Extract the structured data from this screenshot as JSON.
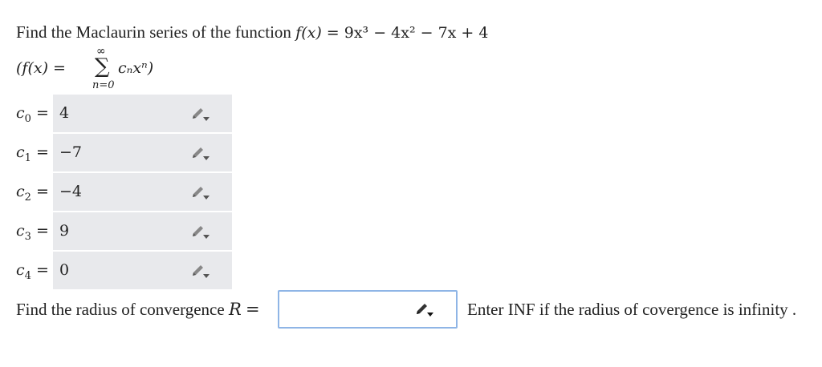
{
  "question": {
    "prefix": "Find the Maclaurin series of the function",
    "function_lhs": "f(x) = ",
    "function_rhs": "9x³ − 4x² − 7x + 4"
  },
  "series_definition": {
    "left": "(f(x) = ",
    "sum_upper": "∞",
    "sum_lower": "n=0",
    "summand": "cₙxⁿ)"
  },
  "coefficients": [
    {
      "label": "c",
      "index": "0",
      "equals": "=",
      "value": "4"
    },
    {
      "label": "c",
      "index": "1",
      "equals": "=",
      "value": "−7"
    },
    {
      "label": "c",
      "index": "2",
      "equals": "=",
      "value": "−4"
    },
    {
      "label": "c",
      "index": "3",
      "equals": "=",
      "value": "9"
    },
    {
      "label": "c",
      "index": "4",
      "equals": "=",
      "value": "0"
    }
  ],
  "radius": {
    "label": "Find the radius of convergence",
    "variable": "R",
    "equals": "=",
    "input_value": "",
    "hint": "Enter INF if the radius of covergence is infinity ."
  },
  "icons": {
    "edit": "pencil-dropdown-icon"
  },
  "colors": {
    "field_background": "#e8e9ec",
    "active_border": "#8fb5e6",
    "icon": "#666666"
  }
}
